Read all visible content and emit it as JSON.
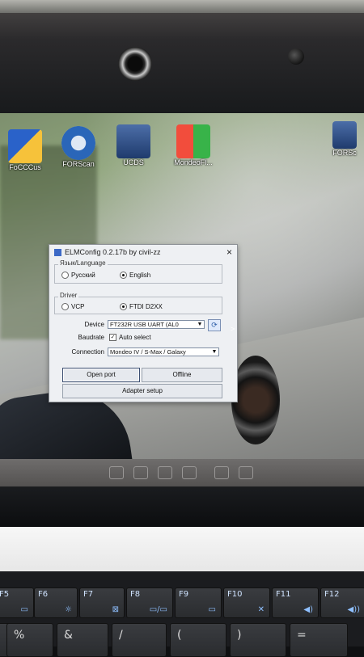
{
  "desktop": {
    "icons": [
      {
        "label": "FoCCCus",
        "kind": "shield"
      },
      {
        "label": "FORScan",
        "kind": "circle"
      },
      {
        "label": "UCDS",
        "kind": "dark"
      },
      {
        "label": "MondeoFl...",
        "kind": "flag"
      },
      {
        "label": "FORSc",
        "kind": "dark"
      }
    ]
  },
  "dialog": {
    "title": "ELMConfig 0.2.17b by civil-zz",
    "close": "×",
    "language": {
      "legend": "Язык/Language",
      "opt1": "Русский",
      "opt2": "English",
      "selected": "English"
    },
    "driver": {
      "legend": "Driver",
      "opt1": "VCP",
      "opt2": "FTDI D2XX",
      "selected": "FTDI D2XX"
    },
    "device_label": "Device",
    "device_value": "FT232R USB UART (AL0",
    "refresh": "⟳",
    "baudrate_label": "Baudrate",
    "auto_select_label": "Auto select",
    "auto_select_checked": true,
    "connection_label": "Connection",
    "connection_value": "Mondeo IV / S-Max / Galaxy",
    "open_port_btn": "Open port",
    "offline_btn": "Offline",
    "adapter_setup_btn": "Adapter setup"
  },
  "keyboard": {
    "fkeys": [
      {
        "label": "F5",
        "sym": "▭"
      },
      {
        "label": "F6",
        "sym": "☼"
      },
      {
        "label": "F7",
        "sym": "⊠"
      },
      {
        "label": "F8",
        "sym": "▭/▭"
      },
      {
        "label": "F9",
        "sym": "▭"
      },
      {
        "label": "F10",
        "sym": "✕"
      },
      {
        "label": "F11",
        "sym": "◀)"
      },
      {
        "label": "F12",
        "sym": "◀))"
      }
    ],
    "row2": [
      "%",
      "&",
      "/",
      "(",
      ")",
      "="
    ]
  }
}
